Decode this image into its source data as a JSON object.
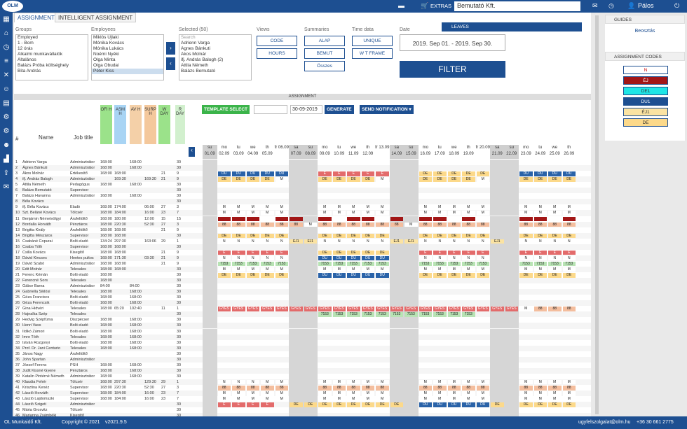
{
  "app": {
    "logo": "OLM",
    "company": "Bemutató Kft.",
    "extras": "EXTRAS",
    "user": "Pálos",
    "flag": "flag-icon"
  },
  "footer": {
    "left": "OL Munkaidő Kft.",
    "copy": "Copyright © 2021",
    "ver": "v2021.9.5",
    "email": "ugyfelszolgalat@olm.hu",
    "phone": "+36 30 661 2775"
  },
  "tabs": [
    "ASSIGNMENT",
    "INTELLIGENT ASSIGNMENT"
  ],
  "labels": {
    "groups": "Groups",
    "employees": "Employees",
    "selected": "Selected (50)",
    "views": "Views",
    "summaries": "Summaries",
    "time": "Time data",
    "date": "Date"
  },
  "groups": [
    "Employed",
    "1 - Bom",
    "12 órás",
    "Alkalmi munkavállalók",
    "Általános",
    "Balázs Próba költséghely",
    "Bita András"
  ],
  "employees": [
    "Miklós Újlaki",
    "Mónika Kovács",
    "Mónika Lukács",
    "Noémi Nyéki",
    "Olga Minta",
    "Olga Óbudai",
    "Péter Kiss"
  ],
  "selected_search": "Search",
  "selected": [
    "Adrienn Varga",
    "Ágnes Bánkuti",
    "Ákos Molnár",
    "ifj. András Balogh (2)",
    "Attila Németh",
    "Balázs Bemutató"
  ],
  "views": [
    "CODE",
    "HOURS"
  ],
  "summaries": [
    "ALAP",
    "BEMUT",
    "Összes"
  ],
  "timedata": [
    "UNIQUE",
    "W T FRAME"
  ],
  "date_range": "2019. Sep 01. - 2019. Sep 30.",
  "filter": "FILTER",
  "leaves": "LEAVES",
  "assignment_title": "ASSIGNMENT",
  "template_select": "TEMPLATE SELECT",
  "gen_date": "30-09-2019",
  "generate": "GENERATE",
  "send": "SEND NOTIFICATION ▾",
  "cols": {
    "num": "#",
    "name": "Name",
    "job": "Job title",
    "ofih": "OFI H",
    "asmh": "ASM H",
    "avh": "AV H",
    "surph": "SURP H",
    "wday": "W DAY",
    "rday": "R DAY"
  },
  "days": [
    [
      "su",
      "01.09"
    ],
    [
      "mo",
      "02.09"
    ],
    [
      "tu",
      "03.09"
    ],
    [
      "we",
      "04.09"
    ],
    [
      "th",
      "05.09"
    ],
    [
      "fr",
      "06.09"
    ],
    [
      "sa",
      "07.09"
    ],
    [
      "su",
      "08.09"
    ],
    [
      "mo",
      "09.09"
    ],
    [
      "tu",
      "10.09"
    ],
    [
      "we",
      "11.09"
    ],
    [
      "th",
      "12.09"
    ],
    [
      "fr",
      "13.09"
    ],
    [
      "sa",
      "14.09"
    ],
    [
      "su",
      "15.09"
    ],
    [
      "mo",
      "16.09"
    ],
    [
      "tu",
      "17.09"
    ],
    [
      "we",
      "18.09"
    ],
    [
      "th",
      "19.09"
    ],
    [
      "fr",
      "20.09"
    ],
    [
      "sa",
      "21.09"
    ],
    [
      "su",
      "22.09"
    ],
    [
      "mo",
      "23.09"
    ],
    [
      "tu",
      "24.09"
    ],
    [
      "we",
      "25.09"
    ],
    [
      "th",
      "26.09"
    ]
  ],
  "rows": [
    [
      "1",
      "Adrienn Varga",
      "Adminisztrátor",
      "168:00",
      "",
      "168:00",
      "",
      "",
      "30"
    ],
    [
      "2",
      "Ágnes Bánkuti",
      "Adminisztrátor",
      "168:00",
      "",
      "168:00",
      "",
      "",
      "30"
    ],
    [
      "3",
      "Ákos Molnár",
      "Értékesítő",
      "168:00",
      "168:00",
      "",
      "",
      "21",
      "9"
    ],
    [
      "4",
      "ifj. András Balogh",
      "Adminisztrátor",
      "",
      "169:30",
      "",
      "169:30",
      "21",
      "9"
    ],
    [
      "5",
      "Attila Németh",
      "Pedagógus",
      "168:00",
      "",
      "168:00",
      "",
      "",
      "30"
    ],
    [
      "6",
      "Balázs Bemutató",
      "Supervisor",
      "",
      "",
      "",
      "",
      "",
      "30"
    ],
    [
      "7",
      "Balázs Havanna",
      "Adminisztrátor",
      "168:00",
      "",
      "168:00",
      "",
      "",
      "30"
    ],
    [
      "8",
      "Béla Kovács",
      "",
      "",
      "",
      "",
      "",
      "",
      "30"
    ],
    [
      "9",
      "ifj. Béla Kovács",
      "Eladó",
      "168:00",
      "174:00",
      "",
      "06:00",
      "27",
      "3"
    ],
    [
      "10",
      "Szt. Beláné Kovács",
      "Tölcsér",
      "168:00",
      "184:00",
      "",
      "16:00",
      "23",
      "7"
    ],
    [
      "11",
      "Benjámin Németvölgyi",
      "Árufeltöltő",
      "168:00",
      "180:00",
      "",
      "12:00",
      "15",
      "15"
    ],
    [
      "12",
      "Bordalla Horváth",
      "Pénztáros",
      "168:00",
      "220:30",
      "",
      "52:30",
      "27",
      "3"
    ],
    [
      "13",
      "Brigitta Király",
      "Árufeltöltő",
      "168:00",
      "168:00",
      "",
      "",
      "21",
      "9"
    ],
    [
      "14",
      "Brigitta Mészáros",
      "Supervisor",
      "168:00",
      "168:00",
      "",
      "",
      "",
      "30"
    ],
    [
      "15",
      "Csabáné Copurai",
      "Bolti eladó",
      "134:24",
      "297:30",
      "",
      "163:06",
      "29",
      "1"
    ],
    [
      "16",
      "Csaba Tóth",
      "Supervisor",
      "168:00",
      "168:00",
      "",
      "",
      "",
      "30"
    ],
    [
      "17",
      "Csilla Kovács",
      "Kisegítő",
      "168:00",
      "168:00",
      "",
      "",
      "21",
      "9"
    ],
    [
      "18",
      "Dávid Kincses",
      "Hentes pultos",
      "168:00",
      "171:30",
      "",
      "03:30",
      "21",
      "9"
    ],
    [
      "19",
      "Dávid Szabó",
      "Adminisztrátor",
      "168:00",
      "168:00",
      "",
      "",
      "21",
      "9"
    ],
    [
      "20",
      "Edit Molnár",
      "Telesales",
      "168:00",
      "168:00",
      "",
      "",
      "",
      "30"
    ],
    [
      "21",
      "Ferenc Kémán",
      "Bolti eladó",
      "168:00",
      "",
      "",
      "",
      "",
      "30"
    ],
    [
      "22",
      "Ferencné Sors",
      "Telesales",
      "168:00",
      "",
      "",
      "",
      "",
      "30"
    ],
    [
      "23",
      "Gábor Barna",
      "Adminisztrátor",
      "84:00",
      "",
      "84:00",
      "",
      "",
      "30"
    ],
    [
      "24",
      "Gabriella Siklósi",
      "Telesales",
      "168:00",
      "",
      "168:00",
      "",
      "",
      "30"
    ],
    [
      "25",
      "Géza Franciscs",
      "Bolti eladó",
      "168:00",
      "",
      "168:00",
      "",
      "",
      "30"
    ],
    [
      "26",
      "Géza Ferencsik",
      "Bolti eladó",
      "168:00",
      "",
      "168:00",
      "",
      "",
      "30"
    ],
    [
      "27",
      "Gina Hidvéri",
      "Telesales",
      "168:00",
      "65:20",
      "102:40",
      "",
      "11",
      "1"
    ],
    [
      "28",
      "Hajnalka Szép",
      "Telesales",
      "",
      "",
      "",
      "",
      "",
      "30"
    ],
    [
      "29",
      "Hedvig Szépfüma",
      "Diszpécser",
      "168:00",
      "",
      "168:00",
      "",
      "",
      "30"
    ],
    [
      "30",
      "Henri Vass",
      "Bolti eladó",
      "168:00",
      "",
      "168:00",
      "",
      "",
      "30"
    ],
    [
      "31",
      "Ildikó Zámori",
      "Bolti eladó",
      "168:00",
      "",
      "168:00",
      "",
      "",
      "30"
    ],
    [
      "32",
      "Imre Tóth",
      "Telesales",
      "168:00",
      "",
      "168:00",
      "",
      "",
      "30"
    ],
    [
      "33",
      "István Rozgonyi",
      "Bolti eladó",
      "168:00",
      "",
      "168:00",
      "",
      "",
      "30"
    ],
    [
      "34",
      "Prof. Dr. Jani Centurio",
      "Telesales",
      "168:00",
      "",
      "168:00",
      "",
      "",
      "30"
    ],
    [
      "35",
      "János Nagy",
      "Árufeltöltő",
      "",
      "",
      "",
      "",
      "",
      "30"
    ],
    [
      "36",
      "John Spartan",
      "Adminisztrátor",
      "",
      "",
      "",
      "",
      "",
      "30"
    ],
    [
      "37",
      "József Ferenc",
      "PSH",
      "168:00",
      "",
      "168:00",
      "",
      "",
      "30"
    ],
    [
      "38",
      "Judit Kissné Gyene",
      "Pénztáros",
      "168:00",
      "",
      "168:00",
      "",
      "",
      "30"
    ],
    [
      "39",
      "Katalin Pintérné Németh",
      "Adminisztrátor",
      "168:00",
      "",
      "168:00",
      "",
      "",
      "30"
    ],
    [
      "40",
      "Klaudia Fehér",
      "Tölcsér",
      "168:00",
      "297:30",
      "",
      "129:30",
      "29",
      "1"
    ],
    [
      "41",
      "Krisztina Kenéz",
      "Supervisor",
      "168:00",
      "220:30",
      "",
      "52:30",
      "27",
      "3"
    ],
    [
      "42",
      "László Horváth",
      "Supervisor",
      "168:00",
      "184:00",
      "",
      "16:00",
      "23",
      "7"
    ],
    [
      "43",
      "László Lajdomszki",
      "Supervisor",
      "168:00",
      "184:00",
      "",
      "16:00",
      "23",
      "7"
    ],
    [
      "44",
      "László Szigeti",
      "Adminisztrátor",
      "",
      "",
      "",
      "",
      "",
      "30"
    ],
    [
      "45",
      "Mária Grosvitz",
      "Tölcsér",
      "",
      "",
      "",
      "",
      "",
      "30"
    ],
    [
      "46",
      "Marianna Zsámbéki",
      "Kisegítő",
      "",
      "",
      "",
      "",
      "",
      "30"
    ]
  ],
  "codes": [
    "N",
    "ÉJ",
    "DE1",
    "DU1",
    "ÉJ1",
    "DE"
  ],
  "code_colors": [
    "#ffffff",
    "#a21616",
    "#1ee6e6",
    "#1d4f91",
    "#fbe3a2",
    "#fcd98a"
  ],
  "guides_title": "GUIDES",
  "guides_item": "Beosztás",
  "codes_title": "ASSIGNMENT CODES",
  "cells": {
    "3": {
      "1": "DU",
      "2": "DU",
      "3": "DU",
      "4": "DU",
      "5": "DU",
      "8": "E",
      "9": "E",
      "10": "E",
      "11": "E",
      "12": "E",
      "15": "DE",
      "16": "DE",
      "17": "DE",
      "18": "DE",
      "19": "DE",
      "22": "DU",
      "23": "DU",
      "24": "DU",
      "25": "DU"
    },
    "4": {
      "1": "DE",
      "2": "DE",
      "3": "DE",
      "4": "DE",
      "5": "M",
      "8": "DE",
      "9": "DE",
      "10": "DE",
      "11": "DE",
      "12": "M",
      "15": "DE",
      "16": "DE",
      "17": "DE",
      "18": "DE",
      "19": "M",
      "22": "DE",
      "23": "DE",
      "24": "DE",
      "25": "DE"
    },
    "9": {
      "1": "M",
      "2": "M",
      "3": "M",
      "4": "M",
      "5": "M",
      "8": "M",
      "9": "M",
      "10": "M",
      "11": "M",
      "12": "M",
      "15": "M",
      "16": "M",
      "17": "M",
      "18": "M",
      "19": "M",
      "22": "M",
      "23": "M",
      "24": "M",
      "25": "M"
    },
    "10": {
      "1": "M",
      "2": "M",
      "3": "M",
      "4": "M",
      "5": "M",
      "8": "M",
      "9": "M",
      "10": "M",
      "11": "M",
      "12": "M",
      "15": "M",
      "16": "M",
      "17": "M",
      "18": "M",
      "19": "M",
      "22": "M",
      "23": "M",
      "24": "M",
      "25": "M"
    },
    "11": {
      "1": "DR",
      "2": "DR",
      "3": "DR",
      "5": "DR",
      "6": "DR",
      "8": "DR",
      "10": "DR",
      "11": "DR",
      "13": "DR",
      "15": "DR",
      "16": "DR",
      "18": "DR",
      "22": "DR",
      "23": "DR",
      "25": "DR"
    },
    "12": {
      "1": "88",
      "2": "88",
      "3": "88",
      "4": "88",
      "5": "88",
      "6": "88",
      "7": "M",
      "8": "88",
      "9": "88",
      "10": "88",
      "11": "88",
      "12": "88",
      "13": "88",
      "14": "M",
      "15": "88",
      "16": "88",
      "17": "88",
      "18": "88",
      "19": "88",
      "22": "88",
      "23": "88",
      "24": "88",
      "25": "88"
    },
    "14": {
      "1": "DE",
      "2": "DE",
      "3": "DE",
      "4": "DE",
      "5": "DE",
      "8": "DE",
      "9": "DE",
      "10": "DE",
      "11": "DE",
      "12": "DE",
      "15": "DE",
      "16": "DE",
      "17": "DE",
      "18": "DE",
      "19": "DE",
      "22": "DE",
      "23": "DE",
      "24": "DE",
      "25": "DE"
    },
    "15": {
      "1": "N",
      "2": "N",
      "3": "N",
      "4": "N",
      "5": "N",
      "6": "ÉJ1",
      "7": "ÉJ1",
      "8": "N",
      "9": "N",
      "10": "N",
      "11": "N",
      "12": "N",
      "13": "ÉJ1",
      "14": "ÉJ1",
      "15": "N",
      "16": "N",
      "17": "N",
      "18": "N",
      "19": "N",
      "20": "ÉJ1",
      "22": "N",
      "23": "N",
      "24": "N",
      "25": "N"
    },
    "17": {
      "1": "E",
      "2": "E",
      "3": "E",
      "4": "E",
      "5": "E",
      "8": "DE",
      "9": "DE",
      "10": "DE",
      "11": "DE",
      "12": "DE",
      "15": "E",
      "16": "E",
      "17": "E",
      "18": "E",
      "19": "E",
      "22": "E",
      "23": "E",
      "24": "E",
      "25": "E"
    },
    "18": {
      "1": "N",
      "2": "N",
      "3": "N",
      "4": "N",
      "5": "N",
      "8": "DU",
      "9": "DU",
      "10": "DU",
      "11": "DU",
      "12": "DU",
      "15": "N",
      "16": "N",
      "17": "N",
      "18": "N",
      "19": "N",
      "22": "N",
      "23": "N",
      "24": "N",
      "25": "N"
    },
    "19": {
      "1": "7153",
      "2": "7153",
      "3": "7153",
      "4": "7153",
      "5": "7153",
      "8": "7153",
      "9": "7153",
      "10": "7153",
      "11": "7153",
      "12": "7153",
      "15": "7153",
      "16": "7153",
      "17": "7153",
      "18": "7153",
      "19": "7153",
      "22": "7153",
      "23": "7153",
      "24": "7153",
      "25": "7153"
    },
    "20": {
      "1": "M",
      "2": "M",
      "3": "M",
      "4": "M",
      "5": "M",
      "8": "M",
      "9": "M",
      "10": "M",
      "11": "M",
      "12": "M",
      "15": "M",
      "16": "M",
      "17": "M",
      "18": "M",
      "19": "M",
      "22": "M",
      "23": "M",
      "24": "M",
      "25": "M"
    },
    "21": {
      "1": "DE",
      "2": "DE",
      "3": "DE",
      "4": "DE",
      "5": "DE",
      "8": "DU",
      "9": "DU",
      "10": "DU",
      "11": "DU",
      "12": "DU",
      "15": "DE",
      "16": "DE",
      "17": "DE",
      "18": "DE",
      "19": "DE",
      "22": "DE",
      "23": "DE",
      "24": "DE",
      "25": "DE"
    },
    "27": {
      "1": "GYES",
      "2": "GYES",
      "3": "GYES",
      "4": "GYES",
      "5": "GYES",
      "6": "GYES",
      "7": "GYES",
      "8": "GYES",
      "9": "GYES",
      "10": "GYES",
      "11": "GYES",
      "12": "GYES",
      "13": "GYES",
      "14": "GYES",
      "15": "GYES",
      "16": "GYES",
      "17": "GYES",
      "18": "GYES",
      "19": "GYES",
      "20": "GYES",
      "21": "GYES",
      "22": "M",
      "23": "88",
      "24": "88",
      "25": "88"
    },
    "28": {
      "8": "7153",
      "9": "7153",
      "10": "7153",
      "11": "7153",
      "12": "7153",
      "13": "7153",
      "14": "7153",
      "15": "7153",
      "16": "7153",
      "17": "7153",
      "18": "7153"
    },
    "40": {
      "1": "N",
      "2": "N",
      "3": "N",
      "4": "M",
      "5": "M",
      "8": "M",
      "9": "M",
      "10": "M",
      "11": "M",
      "12": "M",
      "15": "M",
      "16": "M",
      "17": "M",
      "18": "M",
      "19": "M",
      "22": "M",
      "23": "M",
      "24": "M",
      "25": "M"
    },
    "41": {
      "1": "88",
      "2": "88",
      "3": "88",
      "4": "88",
      "5": "88",
      "8": "88",
      "9": "88",
      "10": "88",
      "11": "88",
      "12": "88",
      "15": "88",
      "16": "88",
      "17": "88",
      "18": "88",
      "19": "88",
      "22": "88",
      "23": "88",
      "24": "88",
      "25": "88"
    },
    "42": {
      "1": "M",
      "2": "M",
      "3": "M",
      "4": "M",
      "5": "M",
      "8": "M",
      "9": "M",
      "10": "M",
      "11": "M",
      "12": "M",
      "15": "M",
      "16": "M",
      "17": "M",
      "18": "M",
      "19": "M",
      "22": "M",
      "23": "M",
      "24": "M",
      "25": "M"
    },
    "43": {
      "1": "M",
      "2": "M",
      "3": "M",
      "4": "M",
      "5": "M",
      "8": "M",
      "9": "M",
      "10": "M",
      "11": "M",
      "12": "M",
      "15": "M",
      "16": "M",
      "17": "M",
      "18": "M",
      "19": "M",
      "22": "M",
      "23": "M",
      "24": "M",
      "25": "M"
    },
    "44": {
      "1": "E",
      "2": "E",
      "3": "E",
      "4": "E",
      "6": "DE",
      "7": "DE",
      "8": "DE",
      "9": "DE",
      "10": "DE",
      "11": "DE",
      "12": "DE",
      "13": "DE",
      "15": "DU",
      "16": "DU",
      "17": "DU",
      "18": "DU",
      "19": "DU",
      "20": "DE",
      "22": "DE",
      "23": "DE",
      "24": "DE",
      "25": "DE"
    }
  }
}
